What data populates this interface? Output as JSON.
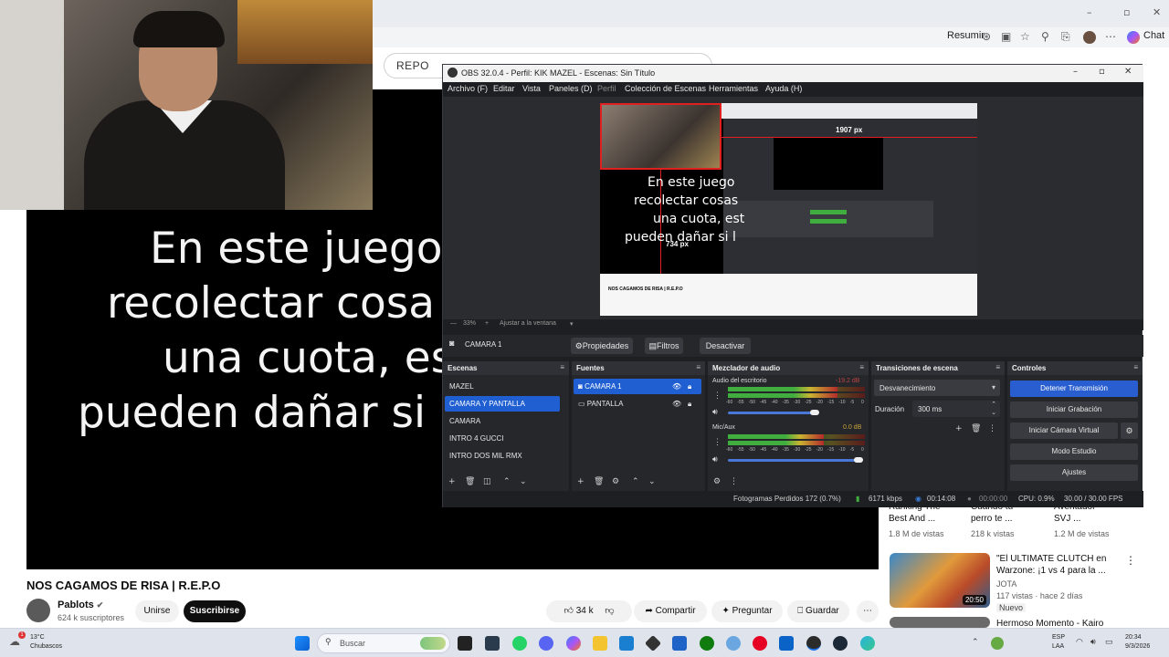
{
  "browser": {
    "search_value": "REPO",
    "resumir": "Resumir",
    "chat": "Chat"
  },
  "video": {
    "subtitles": [
      "En este juego",
      "recolectar cosa",
      "una cuota, es",
      "pueden dañar si"
    ],
    "title": "NOS CAGAMOS DE RISA | R.E.P.O",
    "channel_name": "Pablots",
    "subscribers": "624 k suscriptores",
    "join_label": "Unirse",
    "subscribe_label": "Suscribirse",
    "likes": "34 k",
    "share_label": "Compartir",
    "ask_label": "Preguntar",
    "save_label": "Guardar"
  },
  "recommendations": {
    "top_row": [
      {
        "title": "Ranking The\nBest And ...",
        "views": "1.8 M de vistas"
      },
      {
        "title": "Cuando tu\nperro te ...",
        "views": "218 k vistas"
      },
      {
        "title": "Aventador\nSVJ ...",
        "views": "1.2 M de vistas"
      }
    ],
    "items": [
      {
        "title": "\"El ULTIMATE CLUTCH en\nWarzone: ¡1 vs 4 para la ...",
        "channel": "JOTA",
        "meta": "117 vistas · hace 2 días",
        "badge": "Nuevo",
        "duration": "20:50"
      },
      {
        "title": "Hermoso Momento - Kairo",
        "channel": "",
        "meta": "",
        "badge": "",
        "duration": ""
      }
    ]
  },
  "obs": {
    "title": "OBS 32.0.4 - Perfil: KIK MAZEL - Escenas: Sin Título",
    "menu": [
      "Archivo (F)",
      "Editar",
      "Vista",
      "Paneles (D)",
      "Perfil",
      "Colección de Escenas",
      "Herramientas",
      "Ayuda (H)"
    ],
    "preview": {
      "lines": [
        "En este juego",
        "recolectar cosas",
        "una cuota, est",
        "pueden dañar si l"
      ],
      "dim_w": "1907 px",
      "dim_h": "734 px",
      "caption": "NOS CAGAMOS DE RISA | R.E.P.O"
    },
    "zoom": {
      "percent": "33%",
      "fit_label": "Ajustar a la ventana"
    },
    "source_toolbar": {
      "source_name": "CAMARA 1",
      "properties_label": "Propiedades",
      "filters_label": "Filtros",
      "disable_label": "Desactivar"
    },
    "scenes": {
      "title": "Escenas",
      "items": [
        "MAZEL",
        "CAMARA Y PANTALLA",
        "CAMARA",
        "INTRO 4 GUCCI",
        "INTRO DOS MIL RMX"
      ],
      "selected": "CAMARA Y PANTALLA"
    },
    "sources": {
      "title": "Fuentes",
      "items": [
        "CAMARA 1",
        "PANTALLA"
      ]
    },
    "mixer": {
      "title": "Mezclador de audio",
      "channels": [
        {
          "name": "Audio del escritorio",
          "db": "-19.2 dB",
          "level": 0.8
        },
        {
          "name": "Mic/Aux",
          "db": "0.0 dB",
          "level": 0.7
        }
      ],
      "scale": [
        "-60",
        "-55",
        "-50",
        "-45",
        "-40",
        "-35",
        "-30",
        "-25",
        "-20",
        "-15",
        "-10",
        "-5",
        "0"
      ]
    },
    "transitions": {
      "title": "Transiciones de escena",
      "selected": "Desvanecimiento",
      "duration_label": "Duración",
      "duration_value": "300 ms"
    },
    "controls": {
      "title": "Controles",
      "buttons": [
        "Detener Transmisión",
        "Iniciar Grabación",
        "Iniciar Cámara Virtual",
        "Modo Estudio",
        "Ajustes"
      ]
    },
    "status": {
      "dropped": "Fotogramas Perdidos 172 (0.7%)",
      "bitrate": "6171 kbps",
      "stream_time": "00:14:08",
      "rec_time": "00:00:00",
      "cpu": "CPU: 0.9%",
      "fps": "30.00 / 30.00 FPS"
    }
  },
  "taskbar": {
    "weather_temp": "13°C",
    "weather_desc": "Chubascos",
    "search_placeholder": "Buscar",
    "lang": "ESP",
    "lang2": "LAA",
    "time": "20:34",
    "date": "9/3/2026"
  }
}
